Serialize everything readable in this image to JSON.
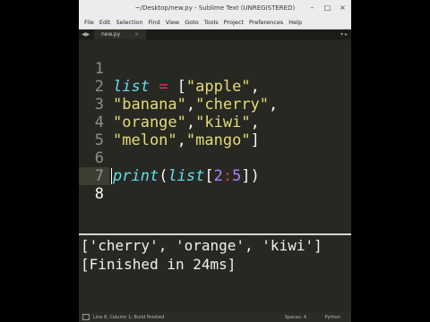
{
  "window": {
    "title": "~/Desktop/new.py - Sublime Text (UNREGISTERED)",
    "controls": [
      "–",
      "□",
      "×"
    ]
  },
  "menu": [
    "File",
    "Edit",
    "Selection",
    "Find",
    "View",
    "Goto",
    "Tools",
    "Project",
    "Preferences",
    "Help"
  ],
  "tab": {
    "arrows": "◀▶",
    "name": "new.py",
    "close": "×",
    "right_controls": "▾ ▸"
  },
  "editor": {
    "line_numbers": [
      "1",
      "2",
      "3",
      "4",
      "5",
      "6",
      "7",
      "8"
    ],
    "active_line": 8,
    "tokens": {
      "l1": [
        "list",
        " = ",
        "[",
        "\"apple\"",
        ","
      ],
      "l2": [
        "\"banana\"",
        ",",
        "\"cherry\"",
        ","
      ],
      "l3": [
        "\"orange\"",
        ",",
        "\"kiwi\"",
        ","
      ],
      "l4": [
        "\"melon\"",
        ",",
        "\"mango\"",
        "]"
      ],
      "l6": [
        "print",
        "(",
        "list",
        "[",
        "2",
        ":",
        "5",
        "])"
      ]
    }
  },
  "console": {
    "output": "['cherry', 'orange', 'kiwi']",
    "finished": "[Finished in 24ms]"
  },
  "status": {
    "left": "Line 8, Column 1; Build finished",
    "spaces": "Spaces: 4",
    "syntax": "Python"
  },
  "colors": {
    "editor_bg": "#272822",
    "keyword": "#66d9ef",
    "operator": "#f92672",
    "string": "#e6db74",
    "number": "#ae81ff"
  }
}
